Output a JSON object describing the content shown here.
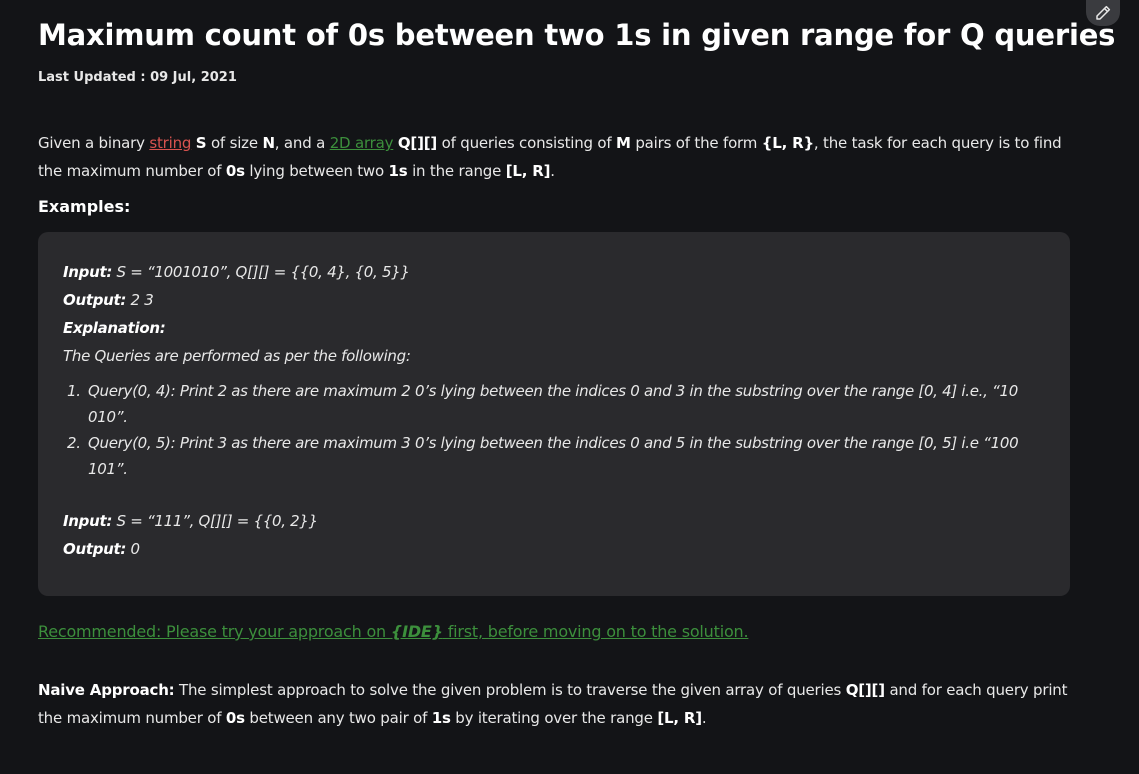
{
  "article": {
    "title": "Maximum count of 0s between two 1s in given range for Q queries",
    "last_updated_label": "Last Updated : ",
    "last_updated_date": "09 Jul, 2021"
  },
  "intro": {
    "t1": "Given a binary ",
    "link_string": "string",
    "t2": " ",
    "s": "S",
    "t3": " of size ",
    "n": "N",
    "t4": ", and a ",
    "link_2d": "2D array",
    "t5": " ",
    "q": "Q[][]",
    "t6": " of queries consisting of ",
    "m": "M",
    "t7": " pairs of the form ",
    "lr": "{L, R}",
    "t8": ", the task for each query is to find the maximum number of ",
    "zeros": "0s",
    "t9": " lying between two ",
    "ones": "1s",
    "t10": " in the range ",
    "range": "[L, R]",
    "t11": "."
  },
  "examples": {
    "heading": "Examples:",
    "input1_label": "Input:",
    "input1_value": " S = “1001010”, Q[][] = {{0, 4}, {0, 5}}",
    "output1_label": "Output:",
    "output1_value": " 2 3",
    "explanation_label": "Explanation:",
    "explanation_text": "The Queries are performed as per the following:",
    "items": [
      {
        "num": "1.",
        "text": "Query(0, 4): Print 2 as there are maximum 2 0’s lying between the indices 0 and 3 in the substring over the range [0, 4] i.e., “10 010”."
      },
      {
        "num": "2.",
        "text": "Query(0, 5): Print 3 as there are maximum 3 0’s lying between the indices 0 and 5 in the substring over the range [0, 5] i.e “100 101”."
      }
    ],
    "input2_label": "Input:",
    "input2_value": " S = “111”, Q[][] = {{0, 2}}",
    "output2_label": "Output:",
    "output2_value": " 0"
  },
  "recommended": {
    "prefix": "Recommended: Please try your approach on ",
    "ide": "{IDE}",
    "suffix": " first, before moving on to the solution."
  },
  "naive": {
    "label": "Naive Approach:",
    "t1": " The simplest approach to solve the given problem is to traverse the given array of queries ",
    "q": "Q[][]",
    "t2": " and for each query print the maximum number of ",
    "zeros": "0s",
    "t3": " between any two pair of ",
    "ones": "1s",
    "t4": " by iterating over the range ",
    "range": "[L, R]",
    "t5": "."
  },
  "toolbar": {
    "edit_icon": "pencil-icon"
  }
}
